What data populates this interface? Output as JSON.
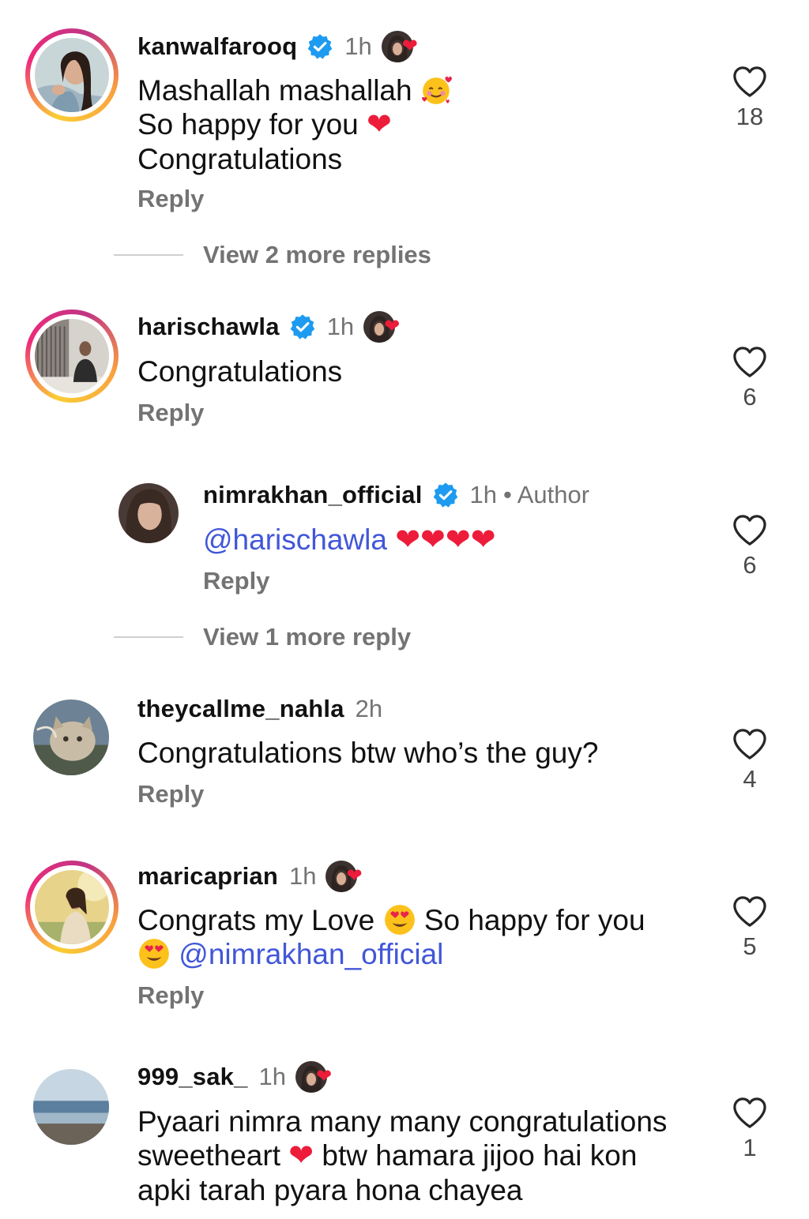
{
  "comments": [
    {
      "username": "kanwalfarooq",
      "verified": true,
      "time": "1h",
      "author_liked": true,
      "lines": [
        "Mashallah mashallah",
        "So happy for you",
        "Congratulations"
      ],
      "reply_label": "Reply",
      "likes": "18",
      "view_more": "View 2 more replies"
    },
    {
      "username": "harischawla",
      "verified": true,
      "time": "1h",
      "author_liked": true,
      "text": "Congratulations",
      "reply_label": "Reply",
      "likes": "6"
    },
    {
      "username": "nimrakhan_official",
      "verified": true,
      "time": "1h",
      "author_badge": "• Author",
      "mention": "@harischawla",
      "reply_label": "Reply",
      "likes": "6",
      "view_more": "View 1 more reply"
    },
    {
      "username": "theycallme_nahla",
      "time": "2h",
      "text": "Congratulations btw who’s the guy?",
      "reply_label": "Reply",
      "likes": "4"
    },
    {
      "username": "maricaprian",
      "time": "1h",
      "author_liked": true,
      "text_a": "Congrats my Love",
      "text_b": "So happy for you",
      "mention": "@nimrakhan_official",
      "reply_label": "Reply",
      "likes": "5"
    },
    {
      "username": "999_sak_",
      "time": "1h",
      "author_liked": true,
      "line1": "Pyaari nimra many many congratulations",
      "line2a": "sweetheart",
      "line2b": "btw hamara jijoo hai kon",
      "line3": "apki tarah pyara hona chayea",
      "likes": "1"
    }
  ],
  "colors": {
    "verified_blue": "#1d9bf0",
    "mention_blue": "#4157d8",
    "heart_red": "#ed1c3a",
    "secondary_text": "#737373"
  },
  "icons": {
    "like": "heart-outline-icon",
    "verified": "verified-badge-icon",
    "author_liked": "author-liked-heart-icon"
  }
}
